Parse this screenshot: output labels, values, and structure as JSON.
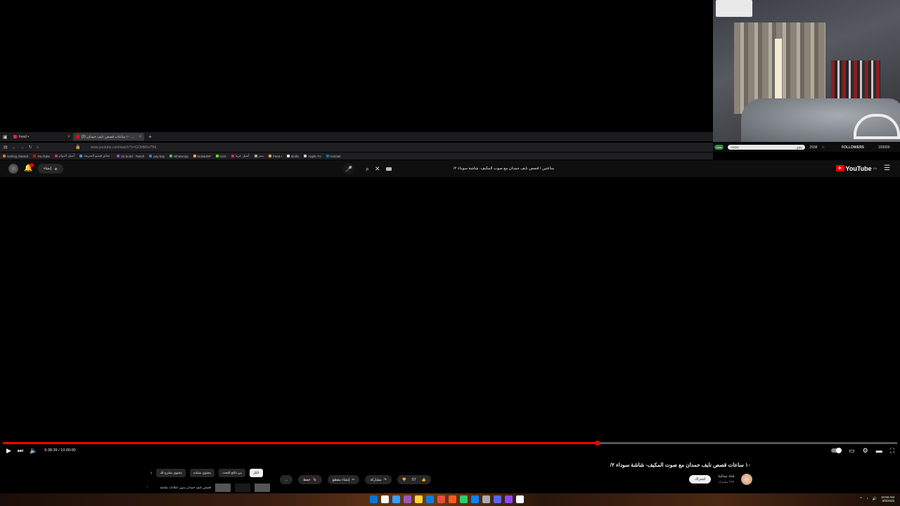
{
  "browser": {
    "tabs": [
      {
        "label": "Feed •",
        "color": "#e0245e",
        "active": false
      },
      {
        "label": "(3) ١٠ ساعات قصص نايف حمدان ...",
        "color": "#ff0000",
        "active": true
      }
    ],
    "new_tab": "+",
    "url": "www.youtube.com/watch?v=GObBtXvTBd",
    "bookmarks": [
      {
        "label": "Getting Started",
        "color": "#e8771d"
      },
      {
        "label": "YouTube",
        "color": "#ff0000"
      },
      {
        "label": "أسيل الدوام",
        "color": "#e0245e"
      },
      {
        "label": "تحدّي فيديو السريعة ·",
        "color": "#4a90d9"
      },
      {
        "label": "(4) brubl - Twitch",
        "color": "#9146ff"
      },
      {
        "label": "pay bay",
        "color": "#3b7bd8"
      },
      {
        "label": "WhatsApp",
        "color": "#25d366"
      },
      {
        "label": "DokanDP",
        "color": "#f2a93b"
      },
      {
        "label": "Kick",
        "color": "#53fc18"
      },
      {
        "label": "أسيل عربة",
        "color": "#e0245e"
      },
      {
        "label": "ممر",
        "color": "#aaaaaa"
      },
      {
        "label": "Feed •",
        "color": "#f2a93b"
      },
      {
        "label": "Botfix",
        "color": "#eeeeee"
      },
      {
        "label": "Apple TV",
        "color": "#cccccc"
      },
      {
        "label": "hotmail",
        "color": "#0078d4"
      }
    ]
  },
  "stream_overlay": {
    "badge": "Live",
    "input_text": "تعليق",
    "input_count": "30305",
    "viewers": "2938",
    "followers_label": "FOLLOWERS",
    "followers_count": "100000"
  },
  "youtube": {
    "create_label": "إنشاء",
    "create_icon": "plus-icon",
    "search_query": "ساعتين / قصص نايف حمدان مع صوت المكيف- شاشة سوداء ٢/",
    "logo_text": "YouTube",
    "logo_superscript": "SA"
  },
  "player": {
    "progress": 0.664,
    "time_current": "6:38:39",
    "time_total": "10:00:00",
    "time_display": "6:38:39 / 10:00:00"
  },
  "video": {
    "title": "١٠ ساعات قصص نايف حمدان مع صوت المكيف- شاشة سوداء ٢/",
    "channel_name": "قناة تسالينا",
    "subscribers": "٢٧٢ مشترك",
    "subscribe_label": "اشتراك",
    "likes": "57",
    "share_label": "مشاركة",
    "clip_label": "إنشاء مقطع",
    "save_label": "حفظ",
    "more_label": "..."
  },
  "chips": [
    {
      "label": "الكل",
      "selected": true
    },
    {
      "label": "من نتائج البحث",
      "selected": false
    },
    {
      "label": "محتوى مشابه",
      "selected": false
    },
    {
      "label": "محتوى مقترح لك",
      "selected": false
    }
  ],
  "recommendation": {
    "title": "قصص نايف حمدان بدون اعلانات شاشه"
  },
  "taskbar": {
    "time": "10:56 AM",
    "date": "8/9/2025",
    "apps": [
      "#0078d4",
      "#ffffff",
      "#3aa0ff",
      "#9b59b6",
      "#ffd23f",
      "#0f7ce6",
      "#e74c3c",
      "#ff5a1f",
      "#2ecc71",
      "#0a84ff",
      "#aaaaaa",
      "#5865f2",
      "#9146ff",
      "#ffffff"
    ]
  }
}
